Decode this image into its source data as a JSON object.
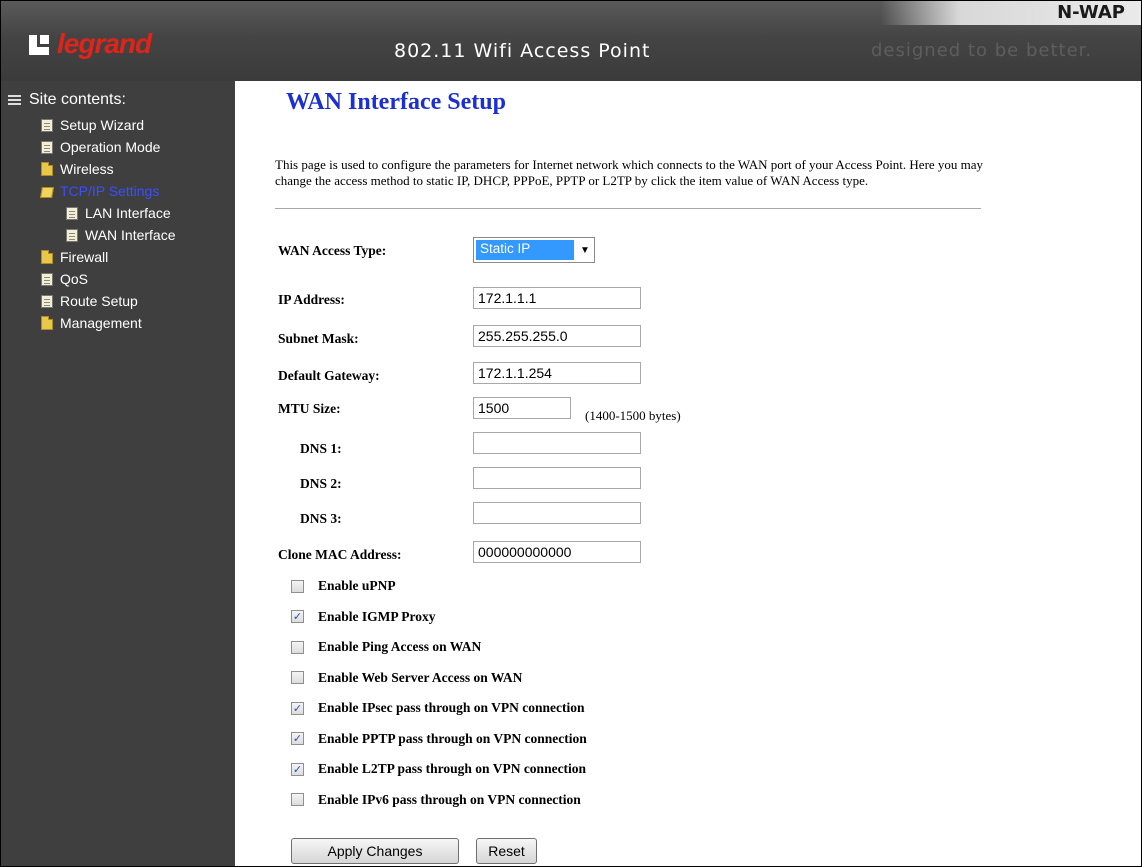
{
  "header": {
    "brand": "legrand",
    "title": "802.11 Wifi Access Point",
    "tagline": "designed to be better.",
    "model": "N-WAP"
  },
  "sidebar": {
    "heading": "Site contents:",
    "items": [
      {
        "label": "Setup Wizard",
        "icon": "document-icon"
      },
      {
        "label": "Operation Mode",
        "icon": "document-icon"
      },
      {
        "label": "Wireless",
        "icon": "folder-icon"
      },
      {
        "label": "TCP/IP Settings",
        "icon": "folder-open-icon",
        "active": true
      },
      {
        "label": "LAN Interface",
        "icon": "document-icon"
      },
      {
        "label": "WAN Interface",
        "icon": "document-icon"
      },
      {
        "label": "Firewall",
        "icon": "folder-icon"
      },
      {
        "label": "QoS",
        "icon": "document-icon"
      },
      {
        "label": "Route Setup",
        "icon": "document-icon"
      },
      {
        "label": "Management",
        "icon": "folder-icon"
      }
    ],
    "active_color": "#3b4fff"
  },
  "main": {
    "title": "WAN Interface Setup",
    "description": "This page is used to configure the parameters for Internet network which connects to the WAN port of your Access Point. Here you may change the access method to static IP, DHCP, PPPoE, PPTP or L2TP by click the item value of WAN Access type.",
    "wan_access_type": {
      "label": "WAN Access Type:",
      "value": "Static IP"
    },
    "fields": {
      "ip_address": {
        "label": "IP Address:",
        "value": "172.1.1.1"
      },
      "subnet_mask": {
        "label": "Subnet Mask:",
        "value": "255.255.255.0"
      },
      "default_gateway": {
        "label": "Default Gateway:",
        "value": "172.1.1.254"
      },
      "mtu_size": {
        "label": "MTU Size:",
        "value": "1500",
        "hint": "(1400-1500 bytes)"
      },
      "dns1": {
        "label": "DNS 1:",
        "value": ""
      },
      "dns2": {
        "label": "DNS 2:",
        "value": ""
      },
      "dns3": {
        "label": "DNS 3:",
        "value": ""
      },
      "clone_mac": {
        "label": "Clone MAC Address:",
        "value": "000000000000"
      }
    },
    "checkboxes": [
      {
        "label": "Enable uPNP",
        "checked": false
      },
      {
        "label": "Enable IGMP Proxy",
        "checked": true
      },
      {
        "label": "Enable Ping Access on WAN",
        "checked": false
      },
      {
        "label": "Enable Web Server Access on WAN",
        "checked": false
      },
      {
        "label": "Enable IPsec pass through on VPN connection",
        "checked": true
      },
      {
        "label": "Enable PPTP pass through on VPN connection",
        "checked": true
      },
      {
        "label": "Enable L2TP pass through on VPN connection",
        "checked": true
      },
      {
        "label": "Enable IPv6 pass through on VPN connection",
        "checked": false
      }
    ],
    "buttons": {
      "apply": "Apply Changes",
      "reset": "Reset"
    }
  },
  "colors": {
    "title_blue": "#1c2fd6",
    "brand_red": "#e2231a",
    "sidebar_bg": "#3f3f3f",
    "select_highlight": "#3399ff"
  }
}
